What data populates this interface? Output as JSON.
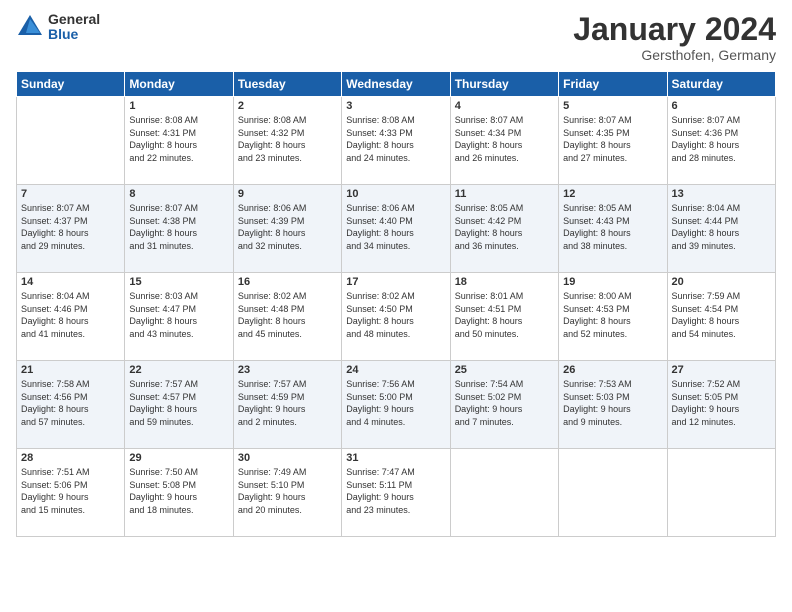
{
  "header": {
    "logo_general": "General",
    "logo_blue": "Blue",
    "month_title": "January 2024",
    "location": "Gersthofen, Germany"
  },
  "days_of_week": [
    "Sunday",
    "Monday",
    "Tuesday",
    "Wednesday",
    "Thursday",
    "Friday",
    "Saturday"
  ],
  "weeks": [
    [
      {
        "day": "",
        "content": ""
      },
      {
        "day": "1",
        "content": "Sunrise: 8:08 AM\nSunset: 4:31 PM\nDaylight: 8 hours\nand 22 minutes."
      },
      {
        "day": "2",
        "content": "Sunrise: 8:08 AM\nSunset: 4:32 PM\nDaylight: 8 hours\nand 23 minutes."
      },
      {
        "day": "3",
        "content": "Sunrise: 8:08 AM\nSunset: 4:33 PM\nDaylight: 8 hours\nand 24 minutes."
      },
      {
        "day": "4",
        "content": "Sunrise: 8:07 AM\nSunset: 4:34 PM\nDaylight: 8 hours\nand 26 minutes."
      },
      {
        "day": "5",
        "content": "Sunrise: 8:07 AM\nSunset: 4:35 PM\nDaylight: 8 hours\nand 27 minutes."
      },
      {
        "day": "6",
        "content": "Sunrise: 8:07 AM\nSunset: 4:36 PM\nDaylight: 8 hours\nand 28 minutes."
      }
    ],
    [
      {
        "day": "7",
        "content": "Sunrise: 8:07 AM\nSunset: 4:37 PM\nDaylight: 8 hours\nand 29 minutes."
      },
      {
        "day": "8",
        "content": "Sunrise: 8:07 AM\nSunset: 4:38 PM\nDaylight: 8 hours\nand 31 minutes."
      },
      {
        "day": "9",
        "content": "Sunrise: 8:06 AM\nSunset: 4:39 PM\nDaylight: 8 hours\nand 32 minutes."
      },
      {
        "day": "10",
        "content": "Sunrise: 8:06 AM\nSunset: 4:40 PM\nDaylight: 8 hours\nand 34 minutes."
      },
      {
        "day": "11",
        "content": "Sunrise: 8:05 AM\nSunset: 4:42 PM\nDaylight: 8 hours\nand 36 minutes."
      },
      {
        "day": "12",
        "content": "Sunrise: 8:05 AM\nSunset: 4:43 PM\nDaylight: 8 hours\nand 38 minutes."
      },
      {
        "day": "13",
        "content": "Sunrise: 8:04 AM\nSunset: 4:44 PM\nDaylight: 8 hours\nand 39 minutes."
      }
    ],
    [
      {
        "day": "14",
        "content": "Sunrise: 8:04 AM\nSunset: 4:46 PM\nDaylight: 8 hours\nand 41 minutes."
      },
      {
        "day": "15",
        "content": "Sunrise: 8:03 AM\nSunset: 4:47 PM\nDaylight: 8 hours\nand 43 minutes."
      },
      {
        "day": "16",
        "content": "Sunrise: 8:02 AM\nSunset: 4:48 PM\nDaylight: 8 hours\nand 45 minutes."
      },
      {
        "day": "17",
        "content": "Sunrise: 8:02 AM\nSunset: 4:50 PM\nDaylight: 8 hours\nand 48 minutes."
      },
      {
        "day": "18",
        "content": "Sunrise: 8:01 AM\nSunset: 4:51 PM\nDaylight: 8 hours\nand 50 minutes."
      },
      {
        "day": "19",
        "content": "Sunrise: 8:00 AM\nSunset: 4:53 PM\nDaylight: 8 hours\nand 52 minutes."
      },
      {
        "day": "20",
        "content": "Sunrise: 7:59 AM\nSunset: 4:54 PM\nDaylight: 8 hours\nand 54 minutes."
      }
    ],
    [
      {
        "day": "21",
        "content": "Sunrise: 7:58 AM\nSunset: 4:56 PM\nDaylight: 8 hours\nand 57 minutes."
      },
      {
        "day": "22",
        "content": "Sunrise: 7:57 AM\nSunset: 4:57 PM\nDaylight: 8 hours\nand 59 minutes."
      },
      {
        "day": "23",
        "content": "Sunrise: 7:57 AM\nSunset: 4:59 PM\nDaylight: 9 hours\nand 2 minutes."
      },
      {
        "day": "24",
        "content": "Sunrise: 7:56 AM\nSunset: 5:00 PM\nDaylight: 9 hours\nand 4 minutes."
      },
      {
        "day": "25",
        "content": "Sunrise: 7:54 AM\nSunset: 5:02 PM\nDaylight: 9 hours\nand 7 minutes."
      },
      {
        "day": "26",
        "content": "Sunrise: 7:53 AM\nSunset: 5:03 PM\nDaylight: 9 hours\nand 9 minutes."
      },
      {
        "day": "27",
        "content": "Sunrise: 7:52 AM\nSunset: 5:05 PM\nDaylight: 9 hours\nand 12 minutes."
      }
    ],
    [
      {
        "day": "28",
        "content": "Sunrise: 7:51 AM\nSunset: 5:06 PM\nDaylight: 9 hours\nand 15 minutes."
      },
      {
        "day": "29",
        "content": "Sunrise: 7:50 AM\nSunset: 5:08 PM\nDaylight: 9 hours\nand 18 minutes."
      },
      {
        "day": "30",
        "content": "Sunrise: 7:49 AM\nSunset: 5:10 PM\nDaylight: 9 hours\nand 20 minutes."
      },
      {
        "day": "31",
        "content": "Sunrise: 7:47 AM\nSunset: 5:11 PM\nDaylight: 9 hours\nand 23 minutes."
      },
      {
        "day": "",
        "content": ""
      },
      {
        "day": "",
        "content": ""
      },
      {
        "day": "",
        "content": ""
      }
    ]
  ]
}
